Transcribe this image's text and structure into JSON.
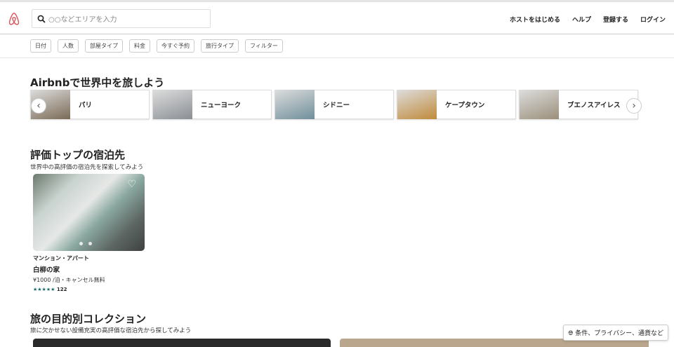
{
  "header": {
    "search_placeholder": "○○などエリアを入力",
    "nav": [
      "ホストをはじめる",
      "ヘルプ",
      "登録する",
      "ログイン"
    ]
  },
  "filters": [
    "日付",
    "人数",
    "部屋タイプ",
    "料金",
    "今すぐ予約",
    "旅行タイプ",
    "フィルター"
  ],
  "explore": {
    "title": "Airbnbで世界中を旅しよう",
    "cities": [
      {
        "name": "パリ",
        "color": "#7a6a55"
      },
      {
        "name": "ニューヨーク",
        "color": "#8a8f94"
      },
      {
        "name": "シドニー",
        "color": "#6f8e9a"
      },
      {
        "name": "ケープタウン",
        "color": "#c08a3a"
      },
      {
        "name": "ブエノスアイレス",
        "color": "#9a8f7a"
      }
    ]
  },
  "top_rated": {
    "title": "評価トップの宿泊先",
    "subtitle": "世界中の高評価の宿泊先を探索してみよう",
    "listing": {
      "type": "マンション・アパート",
      "name": "白柳の家",
      "price": "¥1000 /泊・キャンセル無料",
      "stars": "★★★★★",
      "reviews": "122"
    }
  },
  "collections": {
    "title": "旅の目的別コレクション",
    "subtitle": "旅に欠かせない設備充実の高評価な宿泊先から探してみよう"
  },
  "footer": {
    "label": "条件、プライバシー、通貨など"
  }
}
